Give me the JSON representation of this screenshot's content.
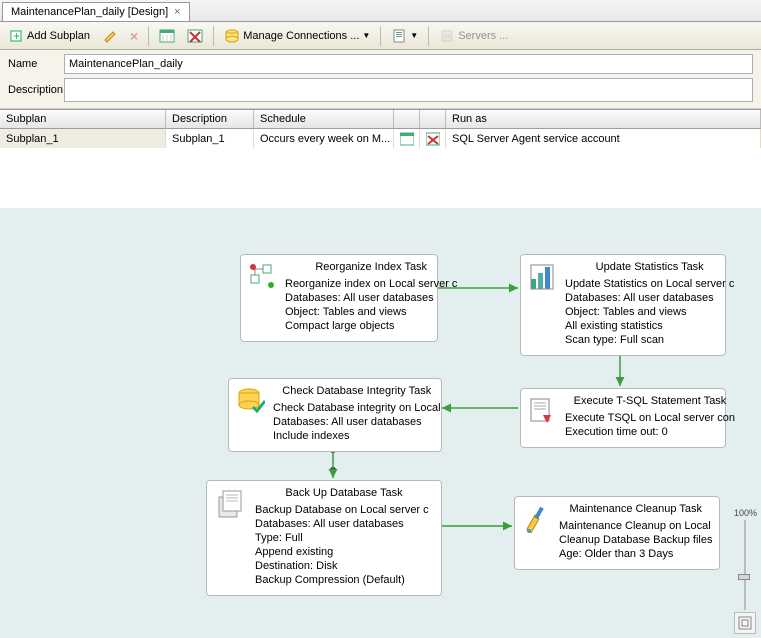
{
  "tab": {
    "title": "MaintenancePlan_daily [Design]"
  },
  "toolbar": {
    "add_subplan": "Add Subplan",
    "manage_conn": "Manage Connections ...",
    "servers": "Servers ..."
  },
  "form": {
    "name_label": "Name",
    "name_value": "MaintenancePlan_daily",
    "desc_label": "Description"
  },
  "grid": {
    "headers": {
      "subplan": "Subplan",
      "desc": "Description",
      "sched": "Schedule",
      "runas": "Run as"
    },
    "row": {
      "subplan": "Subplan_1",
      "desc": "Subplan_1",
      "sched": "Occurs every week on M...",
      "runas": "SQL Server Agent service account"
    }
  },
  "nodes": {
    "reorg": {
      "title": "Reorganize Index Task",
      "l1": "Reorganize index on Local server c",
      "l2": "Databases: All user databases",
      "l3": "Object: Tables and views",
      "l4": "Compact large objects"
    },
    "stats": {
      "title": "Update Statistics Task",
      "l1": "Update Statistics on Local server c",
      "l2": "Databases: All user databases",
      "l3": "Object: Tables and views",
      "l4": "All existing statistics",
      "l5": "Scan type: Full scan"
    },
    "check": {
      "title": "Check Database Integrity Task",
      "l1": "Check Database integrity on Local",
      "l2": "Databases: All user databases",
      "l3": "Include indexes"
    },
    "tsql": {
      "title": "Execute T-SQL Statement Task",
      "l1": "Execute TSQL on Local server con",
      "l2": "Execution time out: 0"
    },
    "backup": {
      "title": "Back Up Database Task",
      "l1": "Backup Database on Local server c",
      "l2": "Databases: All user databases",
      "l3": "Type: Full",
      "l4": "Append existing",
      "l5": "Destination: Disk",
      "l6": "Backup Compression (Default)"
    },
    "cleanup": {
      "title": "Maintenance Cleanup Task",
      "l1": "Maintenance Cleanup on Local",
      "l2": "Cleanup Database Backup files",
      "l3": "Age: Older than 3 Days"
    }
  },
  "zoom": {
    "label": "100%"
  }
}
